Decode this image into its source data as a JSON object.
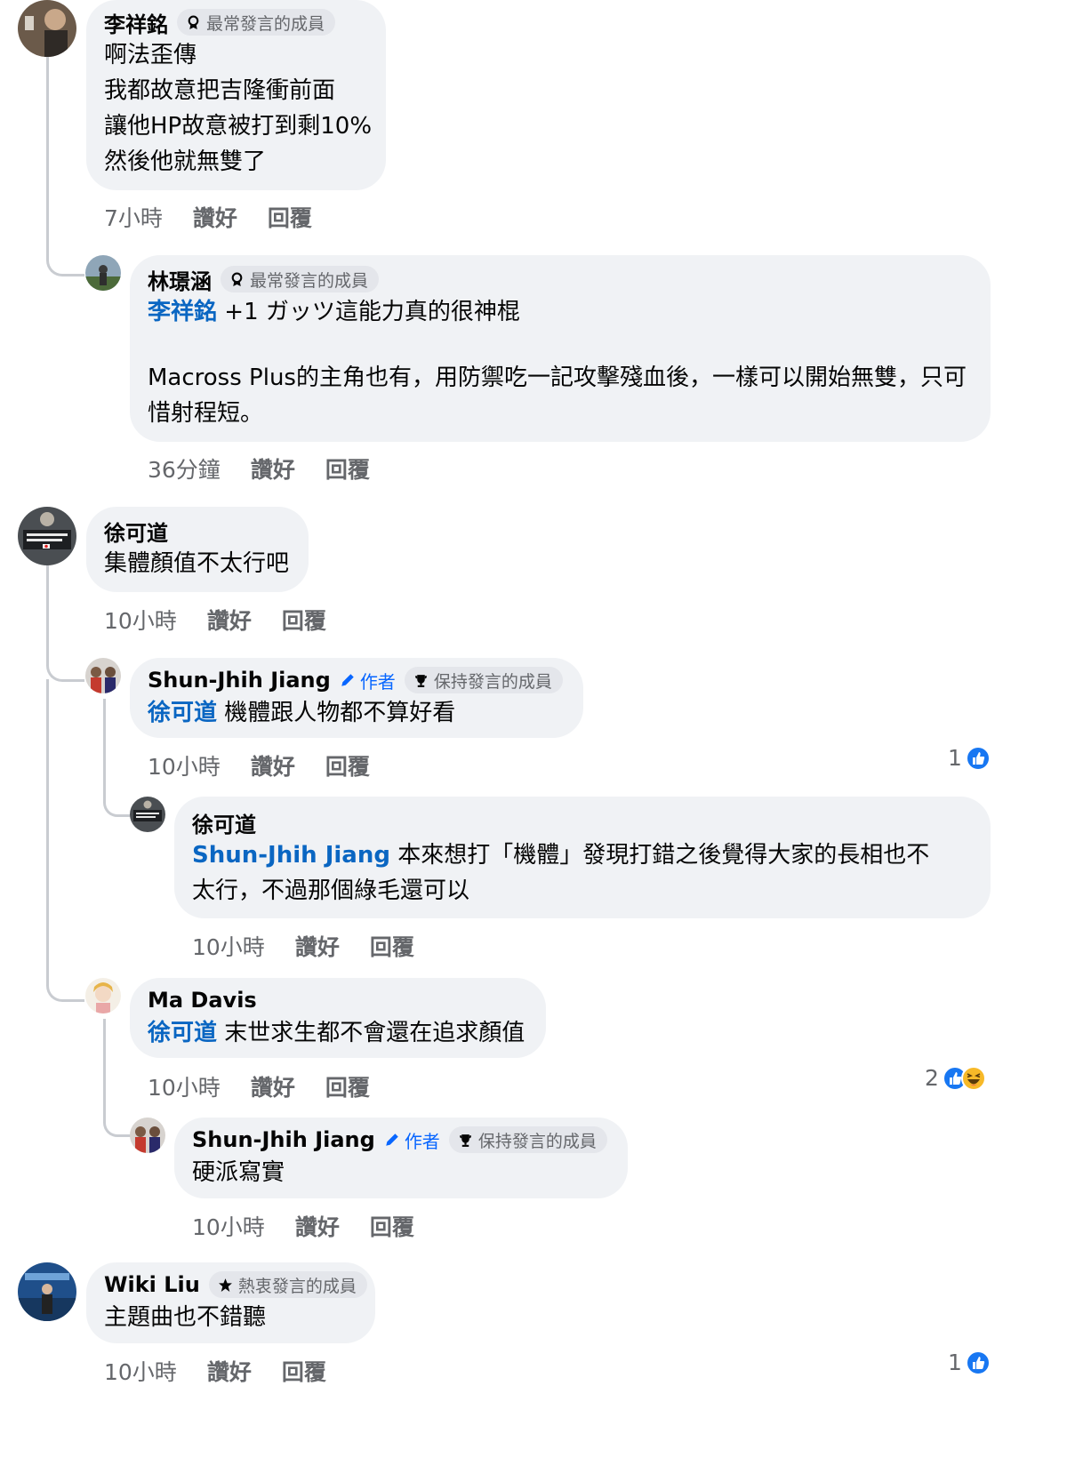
{
  "comments": [
    {
      "name": "李祥銘",
      "badge": "最常發言的成員",
      "badge_icon": "award-icon",
      "lines": [
        "啊法歪傳",
        "我都故意把吉隆衝前面",
        "讓他HP故意被打到剩10%",
        "然後他就無雙了"
      ],
      "time": "7小時",
      "like": "讚好",
      "reply": "回覆"
    },
    {
      "name": "林璟涵",
      "badge": "最常發言的成員",
      "badge_icon": "award-icon",
      "mention": "李祥銘",
      "text1": " +1 ガッツ這能力真的很神棍",
      "text2": "Macross Plus的主角也有，用防禦吃一記攻擊殘血後，一樣可以開始無雙，只可惜射程短。",
      "time": "36分鐘",
      "like": "讚好",
      "reply": "回覆"
    },
    {
      "name": "徐可道",
      "text": "集體顏值不太行吧",
      "time": "10小時",
      "like": "讚好",
      "reply": "回覆"
    },
    {
      "name": "Shun-Jhih Jiang",
      "author": "作者",
      "badge": "保持發言的成員",
      "badge_icon": "trophy-icon",
      "mention": "徐可道",
      "text": " 機體跟人物都不算好看",
      "time": "10小時",
      "like": "讚好",
      "reply": "回覆",
      "reaction_count": "1"
    },
    {
      "name": "徐可道",
      "mention": "Shun-Jhih Jiang",
      "text": " 本來想打「機體」發現打錯之後覺得大家的長相也不太行，不過那個綠毛還可以",
      "time": "10小時",
      "like": "讚好",
      "reply": "回覆"
    },
    {
      "name": "Ma Davis",
      "mention": "徐可道",
      "text": " 末世求生都不會還在追求顏值",
      "time": "10小時",
      "like": "讚好",
      "reply": "回覆",
      "reaction_count": "2"
    },
    {
      "name": "Shun-Jhih Jiang",
      "author": "作者",
      "badge": "保持發言的成員",
      "badge_icon": "trophy-icon",
      "text": "硬派寫實",
      "time": "10小時",
      "like": "讚好",
      "reply": "回覆"
    },
    {
      "name": "Wiki Liu",
      "badge": "熱衷發言的成員",
      "badge_icon": "star-icon",
      "text": "主題曲也不錯聽",
      "time": "10小時",
      "like": "讚好",
      "reply": "回覆",
      "reaction_count": "1"
    }
  ],
  "colors": {
    "bubble": "#f0f2f5",
    "mention": "#0a66c2",
    "like_blue": "#1877f2",
    "meta": "#65676b"
  }
}
